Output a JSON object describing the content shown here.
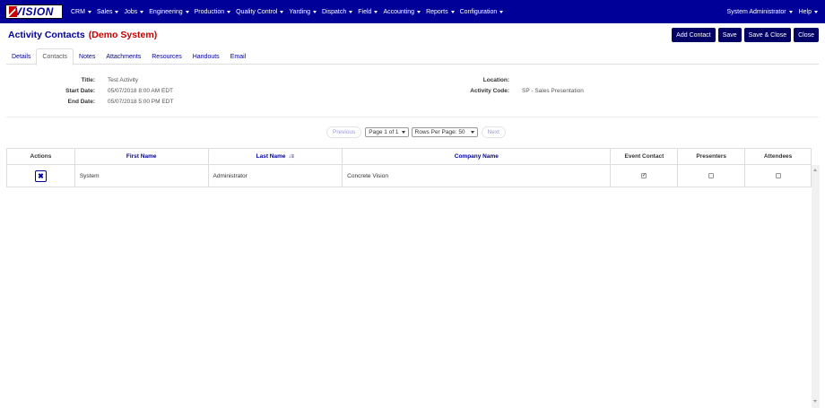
{
  "brand": {
    "logo_text": "VISION"
  },
  "nav": {
    "items": [
      "CRM",
      "Sales",
      "Jobs",
      "Engineering",
      "Production",
      "Quality Control",
      "Yarding",
      "Dispatch",
      "Field",
      "Accounting",
      "Reports",
      "Configuration"
    ],
    "user": "System Administrator",
    "help": "Help"
  },
  "page": {
    "title": "Activity Contacts",
    "subtitle": "(Demo System)"
  },
  "toolbar": {
    "add_contact": "Add Contact",
    "save": "Save",
    "save_close": "Save & Close",
    "close": "Close"
  },
  "tabs": [
    "Details",
    "Contacts",
    "Notes",
    "Attachments",
    "Resources",
    "Handouts",
    "Email"
  ],
  "active_tab": "Contacts",
  "info": {
    "title_label": "Title:",
    "title_value": "Test Activity",
    "start_label": "Start Date:",
    "start_value": "05/07/2018 8:00 AM EDT",
    "end_label": "End Date:",
    "end_value": "05/07/2018 5:00 PM EDT",
    "location_label": "Location:",
    "location_value": "",
    "code_label": "Activity Code:",
    "code_value": "SP - Sales Presentation"
  },
  "pager": {
    "previous": "Previous",
    "page_select": "Page 1 of 1",
    "rows_select": "Rows Per Page: 50",
    "next": "Next"
  },
  "table": {
    "columns": [
      "Actions",
      "First Name",
      "Last Name",
      "Company Name",
      "Event Contact",
      "Presenters",
      "Attendees"
    ],
    "rows": [
      {
        "first_name": "System",
        "last_name": "Administrator",
        "company": "Concrete Vision",
        "event_contact": true,
        "presenter": false,
        "attendee": false
      }
    ]
  },
  "icons": [
    "remove-icon",
    "sort-alpha-icon",
    "caret-down-icon",
    "checkmark-icon"
  ],
  "colors": {
    "nav_bg": "#000099",
    "button_bg": "#000066",
    "link_blue": "#000099",
    "demo_red": "#cc0000"
  }
}
